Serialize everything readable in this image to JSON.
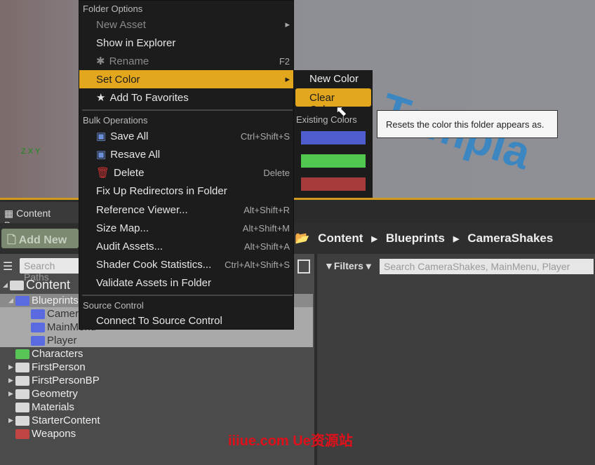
{
  "viewport": {
    "watermark_text": "Templa",
    "axis": "Z X Y"
  },
  "content_browser": {
    "tab": "Content Browser",
    "add_new": "Add New",
    "path": [
      "Content",
      "Blueprints",
      "CameraShakes"
    ],
    "search_paths_placeholder": "Search Paths",
    "filters": "Filters",
    "search_placeholder": "Search CameraShakes, MainMenu, Player",
    "tree": [
      {
        "label": "Content",
        "color": "#d9d9d9",
        "level": 0,
        "expand": "open"
      },
      {
        "label": "Blueprints",
        "color": "#5a6ae0",
        "level": 1,
        "expand": "open"
      },
      {
        "label": "CameraShakes",
        "color": "#5a6ae0",
        "level": 2
      },
      {
        "label": "MainMenu",
        "color": "#5a6ae0",
        "level": 2
      },
      {
        "label": "Player",
        "color": "#5a6ae0",
        "level": 2
      },
      {
        "label": "Characters",
        "color": "#57c657",
        "level": 1
      },
      {
        "label": "FirstPerson",
        "color": "#d9d9d9",
        "level": 1,
        "expand": "closed"
      },
      {
        "label": "FirstPersonBP",
        "color": "#d9d9d9",
        "level": 1,
        "expand": "closed"
      },
      {
        "label": "Geometry",
        "color": "#d9d9d9",
        "level": 1,
        "expand": "closed"
      },
      {
        "label": "Materials",
        "color": "#d9d9d9",
        "level": 1
      },
      {
        "label": "StarterContent",
        "color": "#d9d9d9",
        "level": 1,
        "expand": "closed"
      },
      {
        "label": "Weapons",
        "color": "#c04444",
        "level": 1
      }
    ]
  },
  "menu": {
    "folder_options": "Folder Options",
    "new_asset": "New Asset",
    "show_in_explorer": "Show in Explorer",
    "rename": "Rename",
    "rename_sc": "F2",
    "set_color": "Set Color",
    "add_favorites": "Add To Favorites",
    "bulk": "Bulk Operations",
    "save_all": "Save All",
    "save_all_sc": "Ctrl+Shift+S",
    "resave_all": "Resave All",
    "delete": "Delete",
    "delete_sc": "Delete",
    "fixup": "Fix Up Redirectors in Folder",
    "ref_viewer": "Reference Viewer...",
    "ref_viewer_sc": "Alt+Shift+R",
    "size_map": "Size Map...",
    "size_map_sc": "Alt+Shift+M",
    "audit": "Audit Assets...",
    "audit_sc": "Alt+Shift+A",
    "shader": "Shader Cook Statistics...",
    "shader_sc": "Ctrl+Alt+Shift+S",
    "validate": "Validate Assets in Folder",
    "source_control": "Source Control",
    "connect": "Connect To Source Control"
  },
  "submenu": {
    "new_color": "New Color",
    "clear_color": "Clear Color",
    "existing": "Existing Colors",
    "swatches": [
      "#4e5ecf",
      "#50c850",
      "#a43a3a"
    ]
  },
  "tooltip": "Resets the color this folder appears as.",
  "watermark": "iiiue.com  Ue资源站"
}
